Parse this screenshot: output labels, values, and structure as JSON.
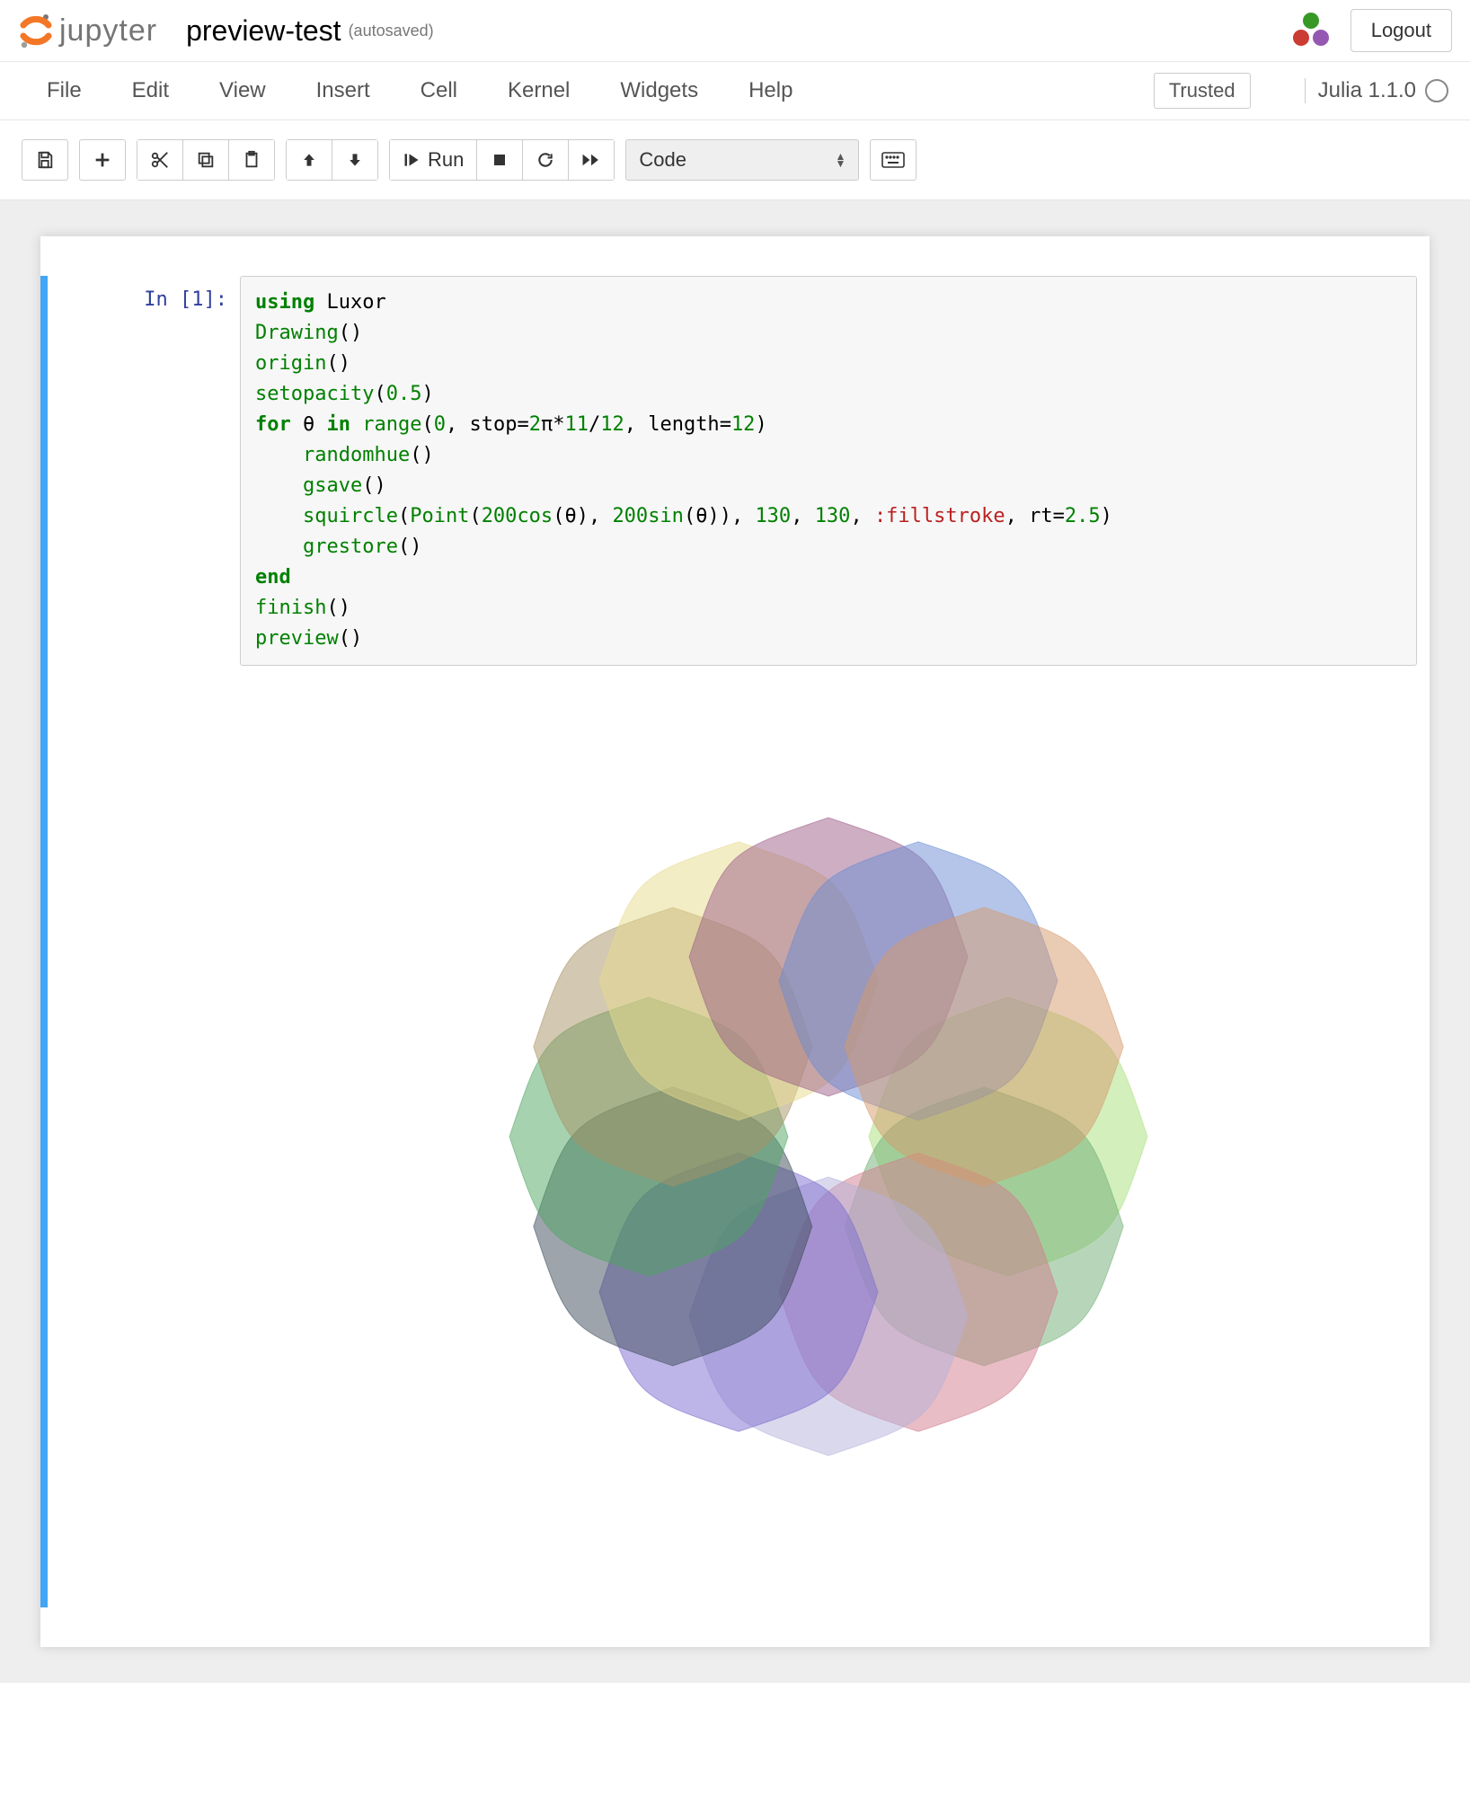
{
  "header": {
    "logo_text": "jupyter",
    "notebook_name": "preview-test",
    "save_status": "(autosaved)",
    "logout_label": "Logout"
  },
  "menubar": {
    "items": [
      "File",
      "Edit",
      "View",
      "Insert",
      "Cell",
      "Kernel",
      "Widgets",
      "Help"
    ],
    "trusted_label": "Trusted",
    "kernel_name": "Julia 1.1.0"
  },
  "toolbar": {
    "save_title": "Save and Checkpoint",
    "add_title": "insert cell below",
    "cut_title": "cut selected cells",
    "copy_title": "copy selected cells",
    "paste_title": "paste cells below",
    "up_title": "move selected cells up",
    "down_title": "move selected cells down",
    "run_label": "Run",
    "run_title": "run cell, select below",
    "stop_title": "interrupt the kernel",
    "restart_title": "restart the kernel",
    "ff_title": "restart the kernel, then re-run the whole notebook",
    "cell_type_selected": "Code",
    "palette_title": "open the command palette"
  },
  "cell1": {
    "prompt": "In [1]:",
    "code": {
      "l1_kw": "using",
      "l1_rest": " Luxor",
      "l2_fn": "Drawing",
      "l2_par": "()",
      "l3_fn": "origin",
      "l3_par": "()",
      "l4_fn": "setopacity",
      "l4_open": "(",
      "l4_num": "0.5",
      "l4_close": ")",
      "l5_kw_for": "for",
      "l5_sp1": " ",
      "l5_var": "θ",
      "l5_sp2": " ",
      "l5_kw_in": "in",
      "l5_sp3": " ",
      "l5_fn_range": "range",
      "l5_open": "(",
      "l5_n0": "0",
      "l5_c1": ", stop",
      "l5_eq1": "=",
      "l5_n2": "2",
      "l5_pi": "π",
      "l5_star": "*",
      "l5_n11": "11",
      "l5_slash": "/",
      "l5_n12": "12",
      "l5_c2": ", length",
      "l5_eq2": "=",
      "l5_n12b": "12",
      "l5_close": ")",
      "l6_ind": "    ",
      "l6_fn": "randomhue",
      "l6_par": "()",
      "l7_ind": "    ",
      "l7_fn": "gsave",
      "l7_par": "()",
      "l8_ind": "    ",
      "l8_fn": "squircle",
      "l8_open": "(",
      "l8_pt": "Point",
      "l8_open2": "(",
      "l8_n200a": "200",
      "l8_cos": "cos",
      "l8_open3": "(",
      "l8_th1": "θ",
      "l8_close3": ")",
      "l8_c1": ", ",
      "l8_n200b": "200",
      "l8_sin": "sin",
      "l8_open4": "(",
      "l8_th2": "θ",
      "l8_close4": ")",
      "l8_close2": ")",
      "l8_c2": ", ",
      "l8_n130a": "130",
      "l8_c3": ", ",
      "l8_n130b": "130",
      "l8_c4": ", ",
      "l8_sym": ":fillstroke",
      "l8_c5": ", rt",
      "l8_eq": "=",
      "l8_n25": "2.5",
      "l8_close": ")",
      "l9_ind": "    ",
      "l9_fn": "grestore",
      "l9_par": "()",
      "l10_kw": "end",
      "l11_fn": "finish",
      "l11_par": "()",
      "l12_fn": "preview",
      "l12_par": "()"
    },
    "output_svg": {
      "shapes": [
        {
          "angle": 0,
          "color": "#a7e07a"
        },
        {
          "angle": 30,
          "color": "#6fae74"
        },
        {
          "angle": 60,
          "color": "#d17b8e"
        },
        {
          "angle": 90,
          "color": "#b6b2d9"
        },
        {
          "angle": 120,
          "color": "#7b6bcf"
        },
        {
          "angle": 150,
          "color": "#3c4a57"
        },
        {
          "angle": 180,
          "color": "#4ea661"
        },
        {
          "angle": 210,
          "color": "#a79263"
        },
        {
          "angle": 240,
          "color": "#e7dc8e"
        },
        {
          "angle": 270,
          "color": "#9c5e87"
        },
        {
          "angle": 300,
          "color": "#6a8bd4"
        },
        {
          "angle": 330,
          "color": "#d59a6b"
        }
      ],
      "radius": 200,
      "half": 155
    }
  }
}
